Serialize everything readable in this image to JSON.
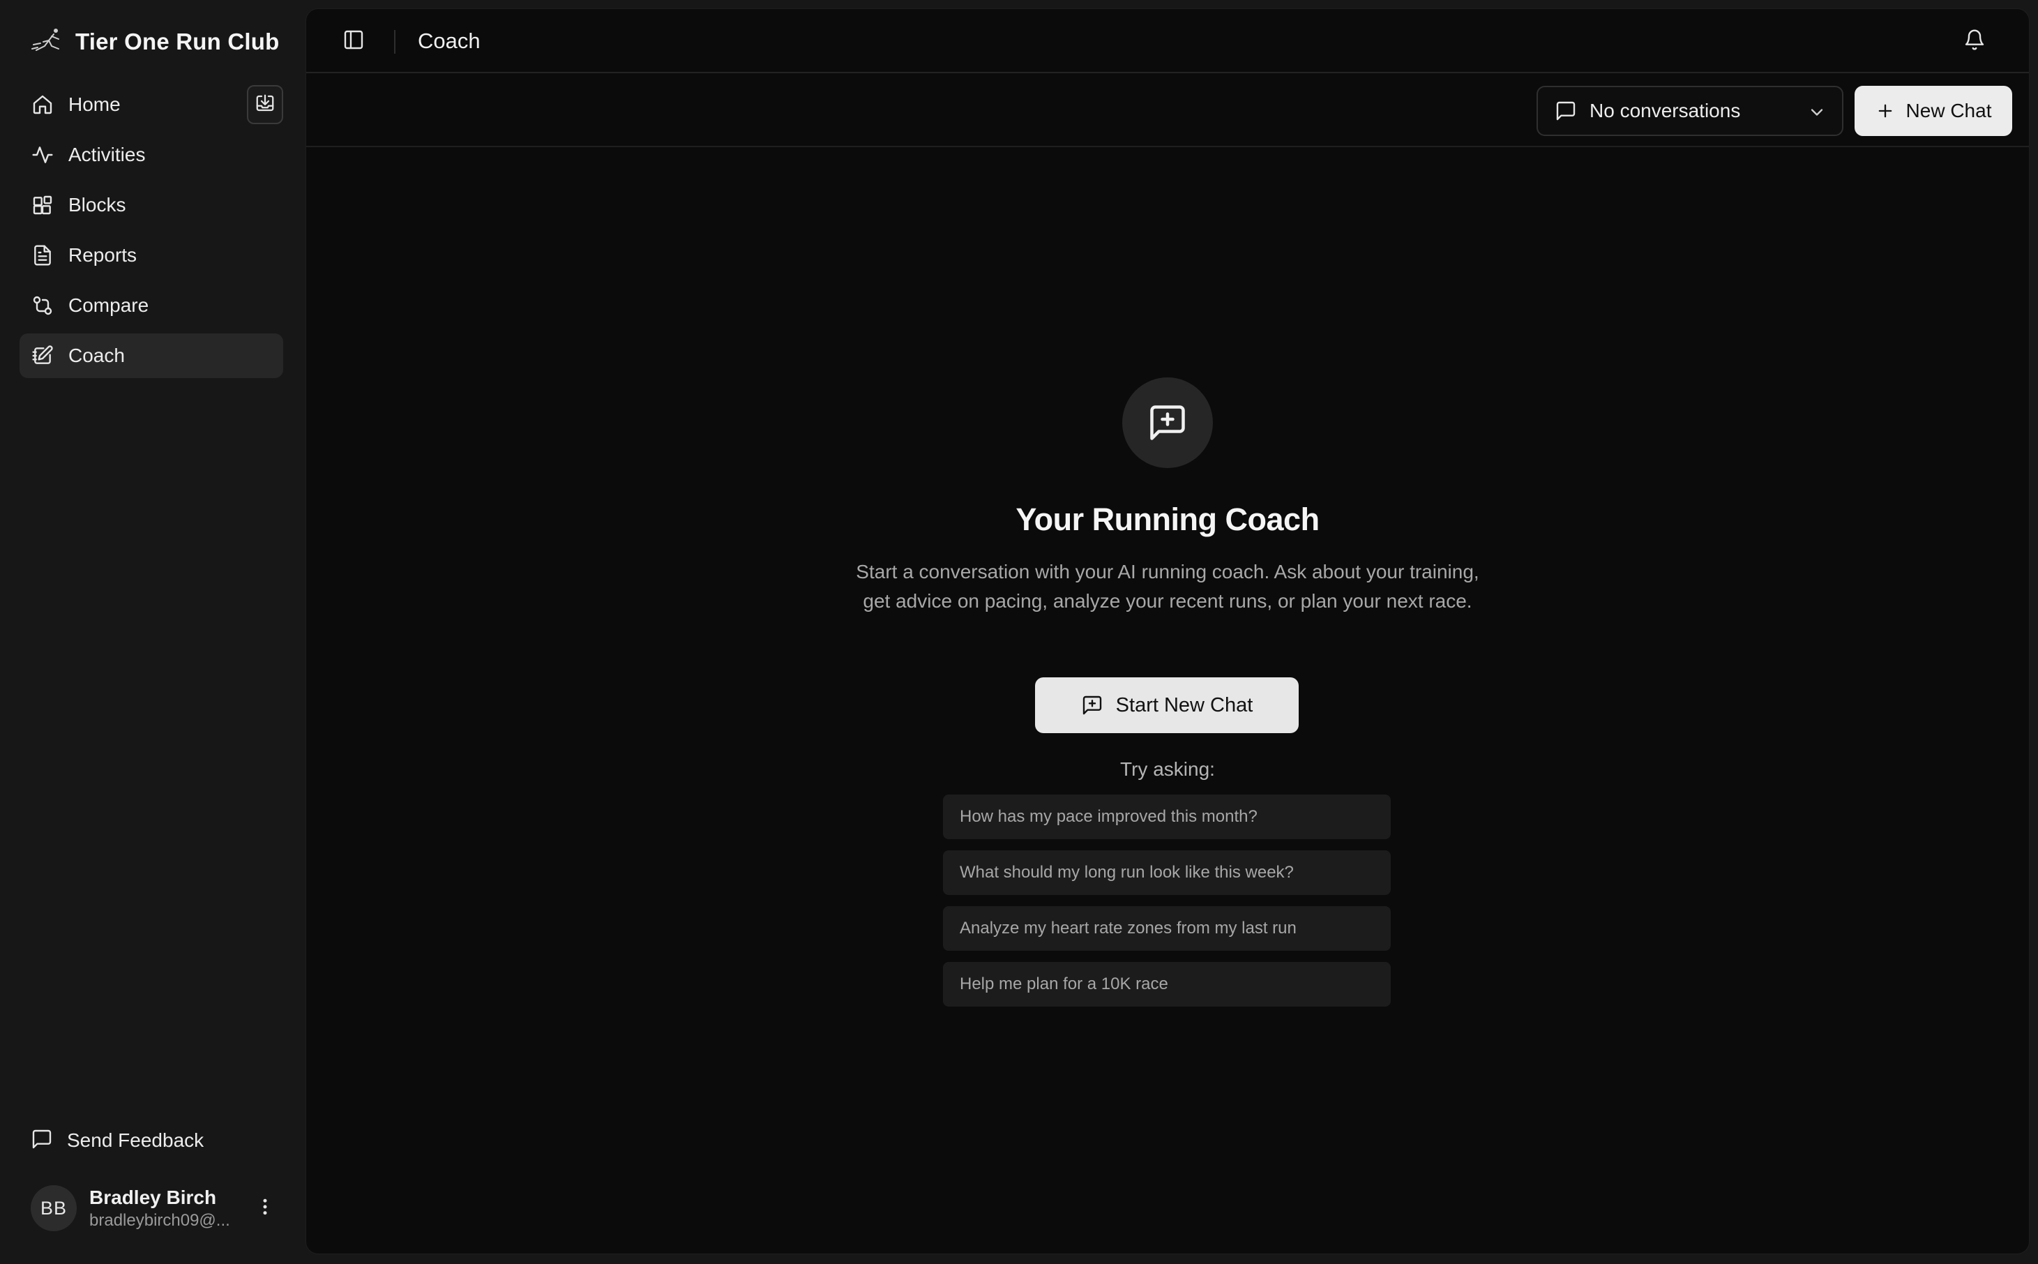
{
  "app": {
    "brand": "Tier One Run Club"
  },
  "sidebar": {
    "import_label": "Import",
    "items": [
      {
        "label": "Home",
        "icon": "home-icon",
        "active": false
      },
      {
        "label": "Activities",
        "icon": "activity-icon",
        "active": false
      },
      {
        "label": "Blocks",
        "icon": "blocks-icon",
        "active": false
      },
      {
        "label": "Reports",
        "icon": "report-icon",
        "active": false
      },
      {
        "label": "Compare",
        "icon": "compare-icon",
        "active": false
      },
      {
        "label": "Coach",
        "icon": "coach-icon",
        "active": true
      }
    ],
    "feedback_label": "Send Feedback",
    "user": {
      "initials": "BB",
      "name": "Bradley Birch",
      "email": "bradleybirch09@..."
    }
  },
  "header": {
    "title": "Coach"
  },
  "toolbar": {
    "conversation_select": "No conversations",
    "new_chat_label": "New Chat"
  },
  "empty_state": {
    "title": "Your Running Coach",
    "description": "Start a conversation with your AI running coach. Ask about your training, get advice on pacing, analyze your recent runs, or plan your next race.",
    "start_button": "Start New Chat",
    "try_label": "Try asking:",
    "suggestions": [
      "How has my pace improved this month?",
      "What should my long run look like this week?",
      "Analyze my heart rate zones from my last run",
      "Help me plan for a 10K race"
    ]
  },
  "colors": {
    "page_bg": "#171717",
    "panel_bg": "#0b0b0b",
    "active_bg": "#272727",
    "button_bg": "#ececec"
  }
}
